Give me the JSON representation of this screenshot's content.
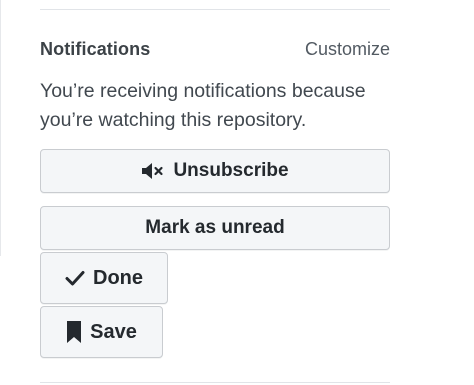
{
  "notifications": {
    "heading": "Notifications",
    "customize_label": "Customize",
    "reason_text": "You’re receiving notifications because you’re watching this repository."
  },
  "buttons": {
    "unsubscribe": {
      "label": "Unsubscribe",
      "icon": "mute-icon"
    },
    "mark_unread": {
      "label": "Mark as unread"
    },
    "done": {
      "label": "Done",
      "icon": "check-icon"
    },
    "save": {
      "label": "Save",
      "icon": "bookmark-icon"
    }
  }
}
